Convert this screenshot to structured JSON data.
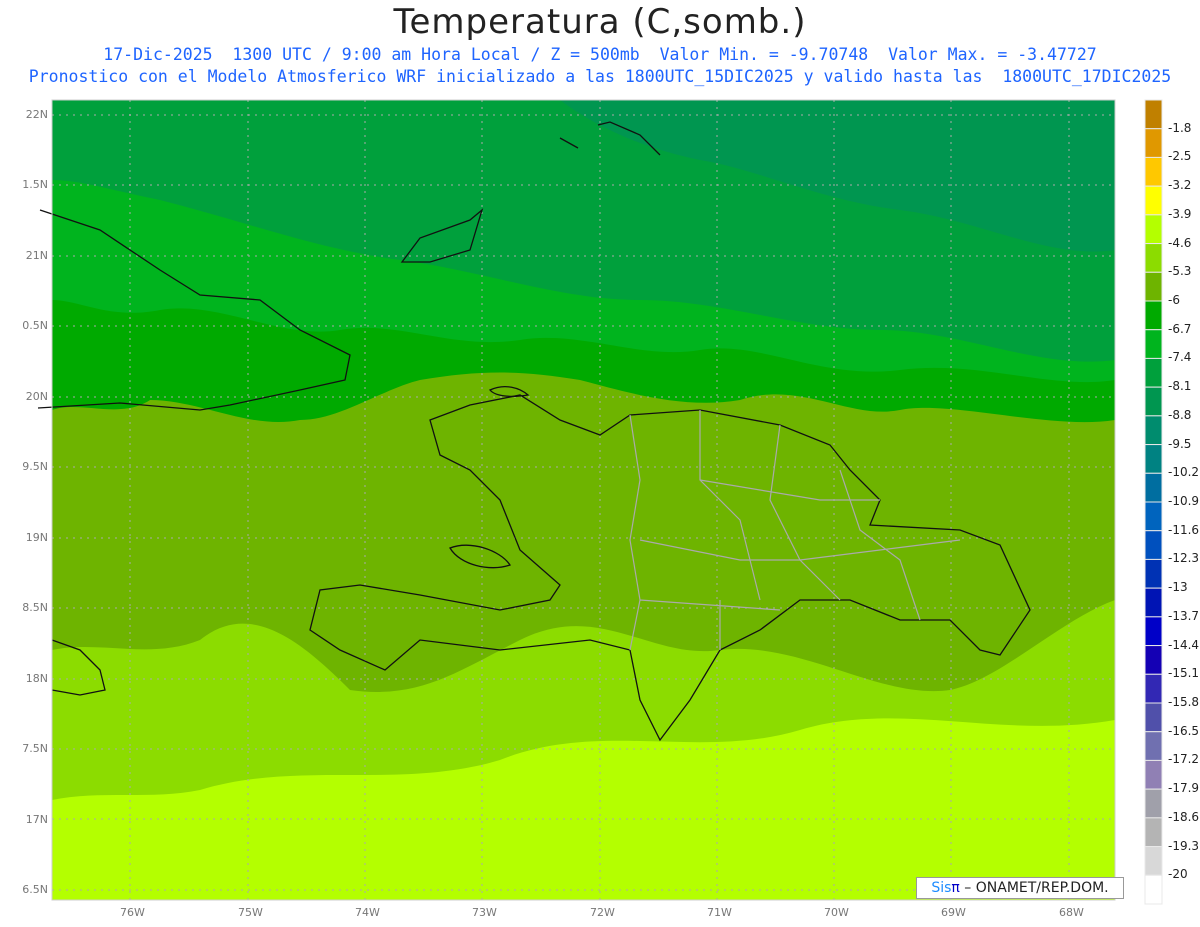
{
  "title": "Temperatura (C,somb.)",
  "subtitle1": "17-Dic-2025  1300 UTC / 9:00 am Hora Local / Z = 500mb  Valor Min. = -9.70748  Valor Max. = -3.47727",
  "subtitle2": "Pronostico con el Modelo Atmosferico WRF inicializado a las 1800UTC_15DIC2025 y valido hasta las  1800UTC_17DIC2025",
  "credit": {
    "sis": "Sis",
    "pi": "π",
    "rest": " – ONAMET/REP.DOM."
  },
  "lon_labels": [
    "76W",
    "75W",
    "74W",
    "73W",
    "72W",
    "71W",
    "70W",
    "69W",
    "68W"
  ],
  "lat_labels": [
    "22N",
    "1.5N",
    "21N",
    "0.5N",
    "20N",
    "9.5N",
    "19N",
    "8.5N",
    "18N",
    "7.5N",
    "17N",
    "6.5N"
  ],
  "colorbar": {
    "labels": [
      "-1.8",
      "-2.5",
      "-3.2",
      "-3.9",
      "-4.6",
      "-5.3",
      "-6",
      "-6.7",
      "-7.4",
      "-8.1",
      "-8.8",
      "-9.5",
      "-10.2",
      "-10.9",
      "-11.6",
      "-12.3",
      "-13",
      "-13.7",
      "-14.4",
      "-15.1",
      "-15.8",
      "-16.5",
      "-17.2",
      "-17.9",
      "-18.6",
      "-19.3",
      "-20"
    ],
    "colors": [
      "#c08000",
      "#e09800",
      "#ffc800",
      "#ffff00",
      "#b4ff00",
      "#8cdc00",
      "#6eb400",
      "#00aa00",
      "#00b41e",
      "#00a03c",
      "#009650",
      "#008c6e",
      "#008282",
      "#006ea0",
      "#0064be",
      "#0050be",
      "#0032b4",
      "#0014b4",
      "#0000c8",
      "#1400b4",
      "#3228b4",
      "#5050aa",
      "#7070b0",
      "#9080b4",
      "#a0a0aa",
      "#b4b4b4",
      "#d8d8d8",
      "#ffffff"
    ]
  }
}
